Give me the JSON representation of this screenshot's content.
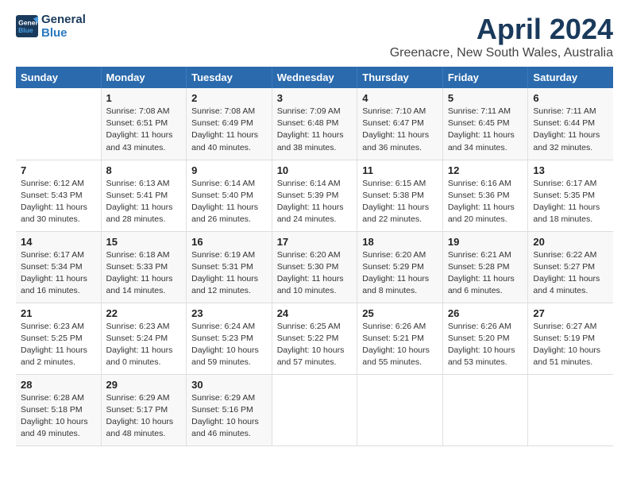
{
  "logo": {
    "line1": "General",
    "line2": "Blue"
  },
  "title": "April 2024",
  "subtitle": "Greenacre, New South Wales, Australia",
  "days_of_week": [
    "Sunday",
    "Monday",
    "Tuesday",
    "Wednesday",
    "Thursday",
    "Friday",
    "Saturday"
  ],
  "weeks": [
    [
      {
        "day": "",
        "info": ""
      },
      {
        "day": "1",
        "info": "Sunrise: 7:08 AM\nSunset: 6:51 PM\nDaylight: 11 hours\nand 43 minutes."
      },
      {
        "day": "2",
        "info": "Sunrise: 7:08 AM\nSunset: 6:49 PM\nDaylight: 11 hours\nand 40 minutes."
      },
      {
        "day": "3",
        "info": "Sunrise: 7:09 AM\nSunset: 6:48 PM\nDaylight: 11 hours\nand 38 minutes."
      },
      {
        "day": "4",
        "info": "Sunrise: 7:10 AM\nSunset: 6:47 PM\nDaylight: 11 hours\nand 36 minutes."
      },
      {
        "day": "5",
        "info": "Sunrise: 7:11 AM\nSunset: 6:45 PM\nDaylight: 11 hours\nand 34 minutes."
      },
      {
        "day": "6",
        "info": "Sunrise: 7:11 AM\nSunset: 6:44 PM\nDaylight: 11 hours\nand 32 minutes."
      }
    ],
    [
      {
        "day": "7",
        "info": "Sunrise: 6:12 AM\nSunset: 5:43 PM\nDaylight: 11 hours\nand 30 minutes."
      },
      {
        "day": "8",
        "info": "Sunrise: 6:13 AM\nSunset: 5:41 PM\nDaylight: 11 hours\nand 28 minutes."
      },
      {
        "day": "9",
        "info": "Sunrise: 6:14 AM\nSunset: 5:40 PM\nDaylight: 11 hours\nand 26 minutes."
      },
      {
        "day": "10",
        "info": "Sunrise: 6:14 AM\nSunset: 5:39 PM\nDaylight: 11 hours\nand 24 minutes."
      },
      {
        "day": "11",
        "info": "Sunrise: 6:15 AM\nSunset: 5:38 PM\nDaylight: 11 hours\nand 22 minutes."
      },
      {
        "day": "12",
        "info": "Sunrise: 6:16 AM\nSunset: 5:36 PM\nDaylight: 11 hours\nand 20 minutes."
      },
      {
        "day": "13",
        "info": "Sunrise: 6:17 AM\nSunset: 5:35 PM\nDaylight: 11 hours\nand 18 minutes."
      }
    ],
    [
      {
        "day": "14",
        "info": "Sunrise: 6:17 AM\nSunset: 5:34 PM\nDaylight: 11 hours\nand 16 minutes."
      },
      {
        "day": "15",
        "info": "Sunrise: 6:18 AM\nSunset: 5:33 PM\nDaylight: 11 hours\nand 14 minutes."
      },
      {
        "day": "16",
        "info": "Sunrise: 6:19 AM\nSunset: 5:31 PM\nDaylight: 11 hours\nand 12 minutes."
      },
      {
        "day": "17",
        "info": "Sunrise: 6:20 AM\nSunset: 5:30 PM\nDaylight: 11 hours\nand 10 minutes."
      },
      {
        "day": "18",
        "info": "Sunrise: 6:20 AM\nSunset: 5:29 PM\nDaylight: 11 hours\nand 8 minutes."
      },
      {
        "day": "19",
        "info": "Sunrise: 6:21 AM\nSunset: 5:28 PM\nDaylight: 11 hours\nand 6 minutes."
      },
      {
        "day": "20",
        "info": "Sunrise: 6:22 AM\nSunset: 5:27 PM\nDaylight: 11 hours\nand 4 minutes."
      }
    ],
    [
      {
        "day": "21",
        "info": "Sunrise: 6:23 AM\nSunset: 5:25 PM\nDaylight: 11 hours\nand 2 minutes."
      },
      {
        "day": "22",
        "info": "Sunrise: 6:23 AM\nSunset: 5:24 PM\nDaylight: 11 hours\nand 0 minutes."
      },
      {
        "day": "23",
        "info": "Sunrise: 6:24 AM\nSunset: 5:23 PM\nDaylight: 10 hours\nand 59 minutes."
      },
      {
        "day": "24",
        "info": "Sunrise: 6:25 AM\nSunset: 5:22 PM\nDaylight: 10 hours\nand 57 minutes."
      },
      {
        "day": "25",
        "info": "Sunrise: 6:26 AM\nSunset: 5:21 PM\nDaylight: 10 hours\nand 55 minutes."
      },
      {
        "day": "26",
        "info": "Sunrise: 6:26 AM\nSunset: 5:20 PM\nDaylight: 10 hours\nand 53 minutes."
      },
      {
        "day": "27",
        "info": "Sunrise: 6:27 AM\nSunset: 5:19 PM\nDaylight: 10 hours\nand 51 minutes."
      }
    ],
    [
      {
        "day": "28",
        "info": "Sunrise: 6:28 AM\nSunset: 5:18 PM\nDaylight: 10 hours\nand 49 minutes."
      },
      {
        "day": "29",
        "info": "Sunrise: 6:29 AM\nSunset: 5:17 PM\nDaylight: 10 hours\nand 48 minutes."
      },
      {
        "day": "30",
        "info": "Sunrise: 6:29 AM\nSunset: 5:16 PM\nDaylight: 10 hours\nand 46 minutes."
      },
      {
        "day": "",
        "info": ""
      },
      {
        "day": "",
        "info": ""
      },
      {
        "day": "",
        "info": ""
      },
      {
        "day": "",
        "info": ""
      }
    ]
  ]
}
